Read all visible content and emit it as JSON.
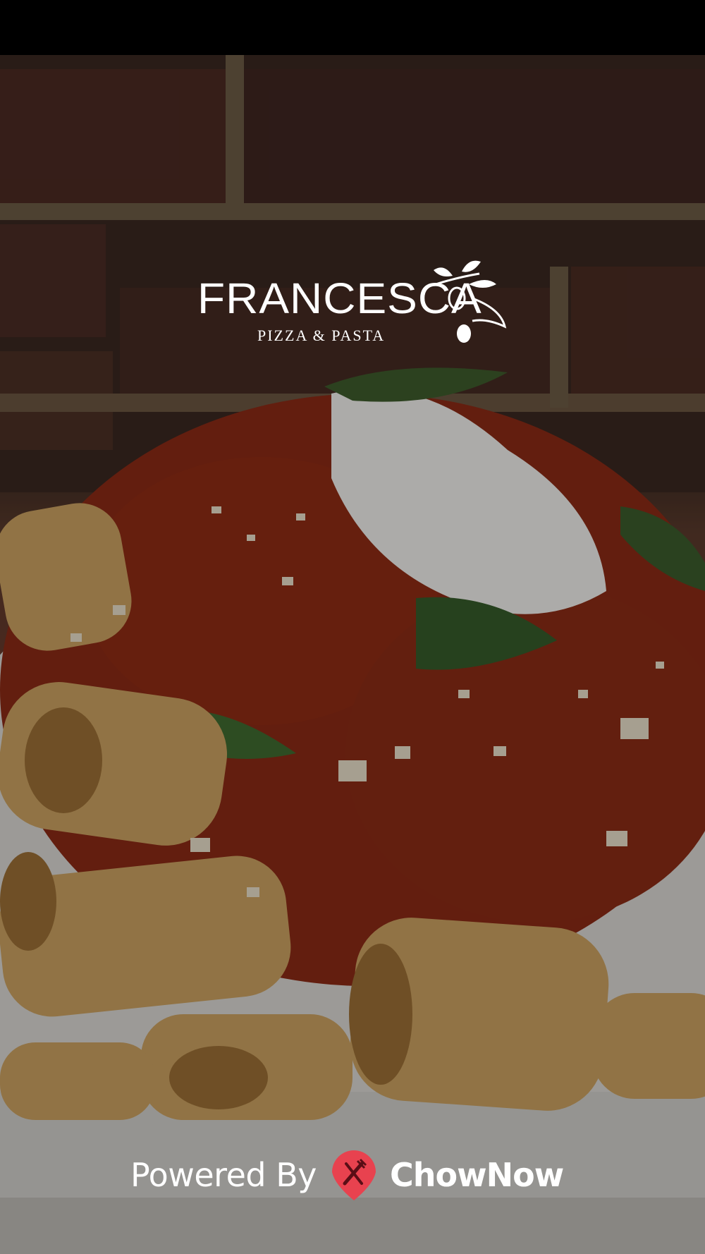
{
  "logo": {
    "name": "FRANCESCA",
    "tagline": "PIZZA & PASTA"
  },
  "footer": {
    "powered_by": "Powered By",
    "brand": "ChowNow",
    "brand_icon": "chownow-fork-knife-icon"
  },
  "colors": {
    "brand_red": "#e8424f",
    "status_bar": "#000000"
  }
}
